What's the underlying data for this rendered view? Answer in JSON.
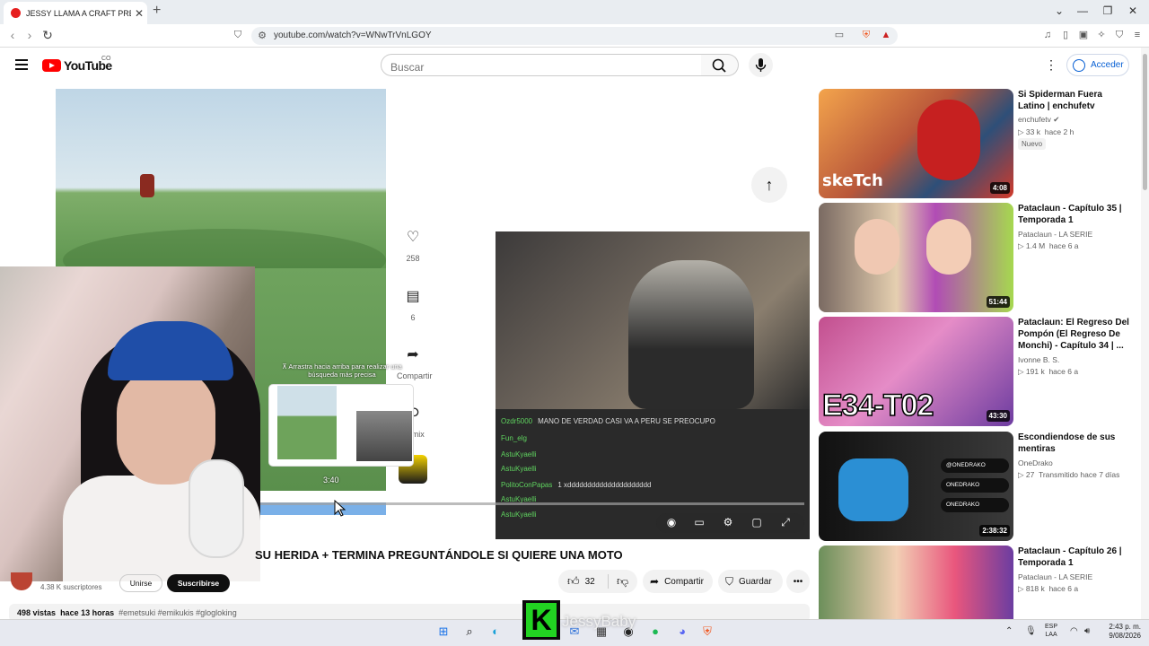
{
  "browser": {
    "tab_title": "JESSY LLAMA A CRAFT PREO",
    "tab_close": "✕",
    "new_tab": "+",
    "url": "youtube.com/watch?v=WNwTrVnLGOY"
  },
  "header": {
    "brand": "YouTube",
    "country": "CO",
    "search_placeholder": "Buscar",
    "signin_label": "Acceder"
  },
  "video": {
    "title": "SU HERIDA + TERMINA PREGUNTÁNDOLE SI QUIERE UNA MOTO",
    "likes_side": "258",
    "comments_side": "6",
    "share_side": "Compartir",
    "remix_side": "Remix",
    "preview_hint": "⊼ Arrastra hacia arriba para realizar una búsqueda más precisa",
    "preview_time": "3:40",
    "subscribers": "4.38 K suscriptores",
    "join_label": "Unirse",
    "subscribe_label": "Suscribirse",
    "like_count": "32",
    "share_label": "Compartir",
    "save_label": "Guardar",
    "views": "498 vistas",
    "age": "hace 13 horas",
    "tags": "#emetsuki #emikukis #glogloking"
  },
  "chat": [
    {
      "user": "Ozdr5000",
      "text": "MANO DE VERDAD CASI VA A PERU SE PREOCUPO"
    },
    {
      "user": "Fun_elg",
      "text": ""
    },
    {
      "user": "AstuKyaelli",
      "text": ""
    },
    {
      "user": "AstuKyaelli",
      "text": ""
    },
    {
      "user": "PolitoConPapas",
      "text": "1 xddddddddddddddddddddd"
    },
    {
      "user": "AstuKyaelli",
      "text": ""
    },
    {
      "user": "AstuKyaelli",
      "text": ""
    }
  ],
  "recommendations": [
    {
      "title": "Si Spiderman Fuera Latino | enchufetv",
      "channel": "enchufetv",
      "views": "33 k",
      "age": "hace 2 h",
      "badge": "Nuevo",
      "duration": "4:08",
      "thumb_text": "skeTch"
    },
    {
      "title": "Pataclaun - Capítulo 35 | Temporada 1",
      "channel": "Pataclaun - LA SERIE",
      "views": "1.4 M",
      "age": "hace 6 a",
      "duration": "51:44"
    },
    {
      "title": "Pataclaun: El Regreso Del Pompón (El Regreso De Monchi) - Capítulo 34 | ...",
      "channel": "Ivonne B. S.",
      "views": "191 k",
      "age": "hace 6 a",
      "duration": "43:30",
      "thumb_text": "E34-T02"
    },
    {
      "title": "Escondiendose de sus mentiras",
      "channel": "OneDrako",
      "views": "27",
      "age": "Transmitido hace 7 días",
      "duration": "2:38:32",
      "socials": [
        "@ONEDRAKO",
        "ONEDRAKO",
        "ONEDRAKO"
      ]
    },
    {
      "title": "Pataclaun - Capítulo 26 | Temporada 1",
      "channel": "Pataclaun - LA SERIE",
      "views": "818 k",
      "age": "hace 6 a",
      "duration": ""
    }
  ],
  "overlay": {
    "k_letter": "K",
    "streamer_name": "JessyBaby"
  },
  "taskbar": {
    "lang_top": "ESP",
    "lang_bottom": "LAA",
    "time": "2:43 p. m.",
    "date": "9/08/2026"
  },
  "colors": {
    "yt_red": "#ff0000",
    "link_blue": "#065fd4",
    "chat_user_green": "#5fd35f"
  }
}
